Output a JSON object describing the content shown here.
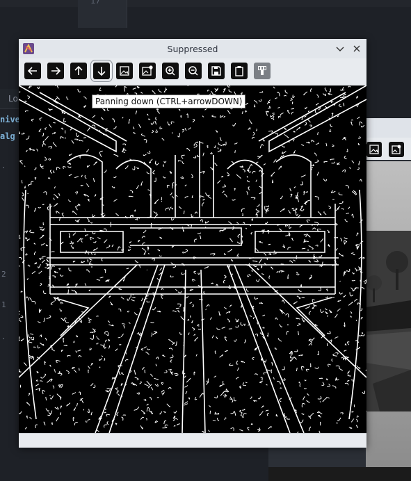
{
  "editor": {
    "line_number": "17",
    "tab_fragment": "Lo",
    "code_fragments": [
      "nive",
      "alg"
    ],
    "gutter_fragments": [
      ".",
      "2",
      "1",
      "."
    ]
  },
  "window": {
    "title": "Suppressed",
    "toolbar": {
      "back": "arrow-left-icon",
      "forward": "arrow-right-icon",
      "pan_up": "arrow-up-icon",
      "pan_down": "arrow-down-icon",
      "home": "image-icon",
      "fit": "image-adjust-icon",
      "zoom_in": "zoom-in-icon",
      "zoom_out": "zoom-out-icon",
      "save": "save-icon",
      "copy": "clipboard-icon",
      "options": "settings-icon"
    },
    "tooltip": "Panning down (CTRL+arrowDOWN)"
  },
  "background_window": {
    "buttons": [
      "image-icon",
      "image-adjust-icon"
    ]
  }
}
